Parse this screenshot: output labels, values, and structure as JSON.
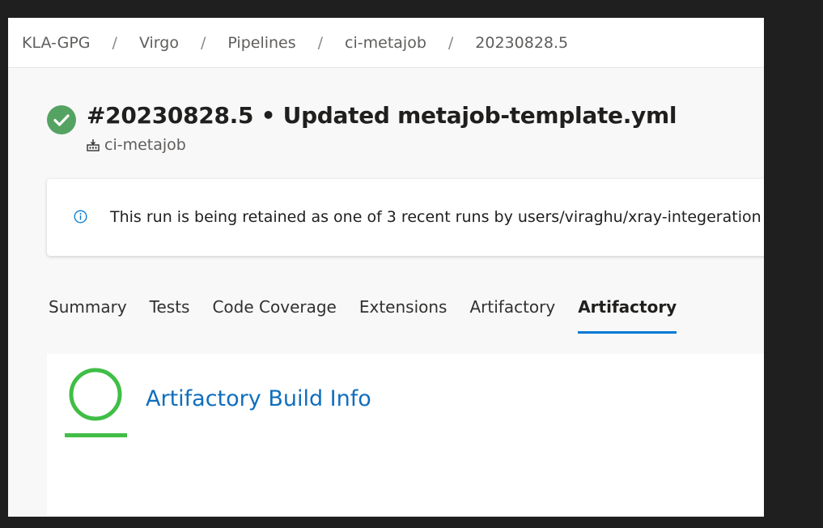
{
  "breadcrumb": {
    "items": [
      "KLA-GPG",
      "Virgo",
      "Pipelines",
      "ci-metajob",
      "20230828.5"
    ],
    "separator": "/"
  },
  "run": {
    "title": "#20230828.5 • Updated metajob-template.yml",
    "pipeline": "ci-metajob",
    "status_color": "#55a362"
  },
  "banner": {
    "text": "This run is being retained as one of 3 recent runs by users/viraghu/xray-integeration (Br",
    "icon": "info-icon"
  },
  "tabs": [
    {
      "label": "Summary",
      "active": false
    },
    {
      "label": "Tests",
      "active": false
    },
    {
      "label": "Code Coverage",
      "active": false
    },
    {
      "label": "Extensions",
      "active": false
    },
    {
      "label": "Artifactory",
      "active": false
    },
    {
      "label": "Artifactory",
      "active": true
    }
  ],
  "content": {
    "link_text": "Artifactory Build Info",
    "logo_color": "#40be46",
    "link_color": "#106ebe"
  },
  "colors": {
    "accent": "#0078d4",
    "page_background": "#1f1f1f"
  }
}
